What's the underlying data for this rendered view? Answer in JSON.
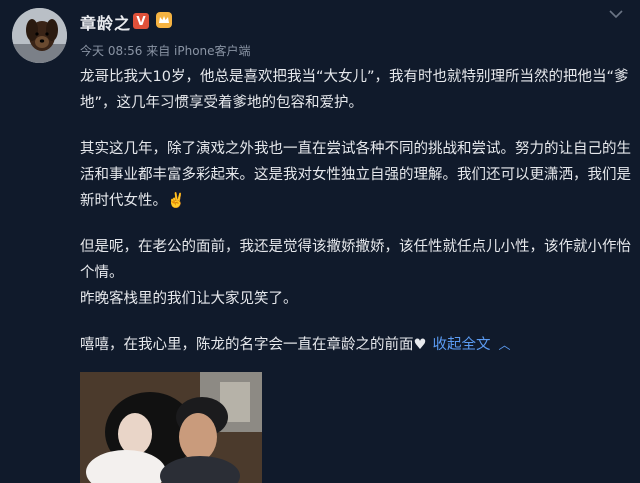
{
  "user": {
    "name": "章龄之",
    "verified_badge": "V",
    "avatar_icon": "dog-avatar-icon",
    "member_icon": "crown-icon"
  },
  "post": {
    "meta": "今天 08:56 来自 iPhone客户端",
    "paragraphs": [
      "龙哥比我大10岁，他总是喜欢把我当“大女儿”，我有时也就特别理所当然的把他当“爹地”，这几年习惯享受着爹地的包容和爱护。",
      "其实这几年，除了演戏之外我也一直在尝试各种不同的挑战和尝试。努力的让自己的生活和事业都丰富多彩起来。这是我对女性独立自强的理解。我们还可以更潇洒，我们是新时代女性。✌️",
      "但是呢，在老公的面前，我还是觉得该撒娇撒娇，该任性就任点儿小性，该作就小作怡个情。",
      "昨晚客栈里的我们让大家见笑了。",
      "嘻嘻，在我心里，陈龙的名字会一直在章龄之的前面"
    ],
    "collapse_label": "收起全文",
    "heart_icon": "heart-icon"
  },
  "colors": {
    "background": "#101a2b",
    "link": "#5b9bf2",
    "verified": "#e0513a"
  }
}
